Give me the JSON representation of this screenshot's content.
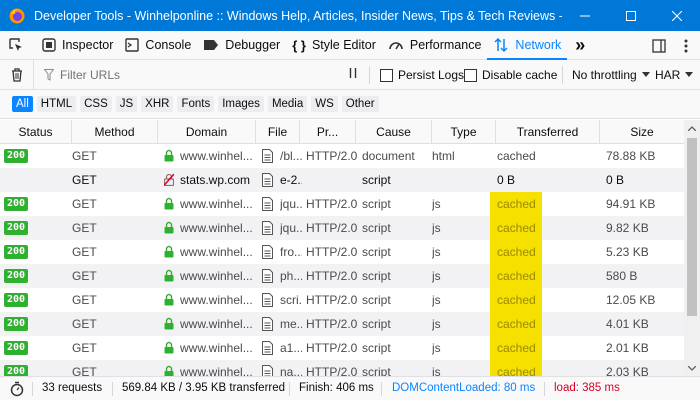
{
  "window": {
    "title": "Developer Tools - Winhelponline :: Windows Help, Articles, Insider News, Tips & Tech Reviews - htt..."
  },
  "toolbar": {
    "tools": [
      {
        "label": "Inspector",
        "icon": "inspector-icon"
      },
      {
        "label": "Console",
        "icon": "console-icon"
      },
      {
        "label": "Debugger",
        "icon": "debugger-icon"
      },
      {
        "label": "Style Editor",
        "icon": "style-editor-icon"
      },
      {
        "label": "Performance",
        "icon": "performance-icon"
      },
      {
        "label": "Network",
        "icon": "network-icon",
        "selected": true
      }
    ],
    "more": "»"
  },
  "filter": {
    "placeholder": "Filter URLs",
    "persist_logs": "Persist Logs",
    "disable_cache": "Disable cache",
    "throttling": "No throttling",
    "har": "HAR"
  },
  "types": [
    "All",
    "HTML",
    "CSS",
    "JS",
    "XHR",
    "Fonts",
    "Images",
    "Media",
    "WS",
    "Other"
  ],
  "columns": [
    "Status",
    "Method",
    "Domain",
    "File",
    "Pr...",
    "Cause",
    "Type",
    "Transferred",
    "Size"
  ],
  "rows": [
    {
      "status": "200",
      "method": "GET",
      "domain": "www.winhel...",
      "secure": true,
      "file": "/bl...",
      "protocol": "HTTP/2.0",
      "cause": "document",
      "type": "html",
      "transferred": "cached",
      "size": "78.88 KB",
      "highlight": false
    },
    {
      "status": "",
      "method": "GET",
      "domain": "stats.wp.com",
      "secure": false,
      "file": "e-2...",
      "protocol": "",
      "cause": "script",
      "type": "",
      "transferred": "0 B",
      "size": "0 B",
      "highlight": false
    },
    {
      "status": "200",
      "method": "GET",
      "domain": "www.winhel...",
      "secure": true,
      "file": "jqu...",
      "protocol": "HTTP/2.0",
      "cause": "script",
      "type": "js",
      "transferred": "cached",
      "size": "94.91 KB",
      "highlight": true
    },
    {
      "status": "200",
      "method": "GET",
      "domain": "www.winhel...",
      "secure": true,
      "file": "jqu...",
      "protocol": "HTTP/2.0",
      "cause": "script",
      "type": "js",
      "transferred": "cached",
      "size": "9.82 KB",
      "highlight": true
    },
    {
      "status": "200",
      "method": "GET",
      "domain": "www.winhel...",
      "secure": true,
      "file": "fro...",
      "protocol": "HTTP/2.0",
      "cause": "script",
      "type": "js",
      "transferred": "cached",
      "size": "5.23 KB",
      "highlight": true
    },
    {
      "status": "200",
      "method": "GET",
      "domain": "www.winhel...",
      "secure": true,
      "file": "ph...",
      "protocol": "HTTP/2.0",
      "cause": "script",
      "type": "js",
      "transferred": "cached",
      "size": "580 B",
      "highlight": true
    },
    {
      "status": "200",
      "method": "GET",
      "domain": "www.winhel...",
      "secure": true,
      "file": "scri...",
      "protocol": "HTTP/2.0",
      "cause": "script",
      "type": "js",
      "transferred": "cached",
      "size": "12.05 KB",
      "highlight": true
    },
    {
      "status": "200",
      "method": "GET",
      "domain": "www.winhel...",
      "secure": true,
      "file": "me...",
      "protocol": "HTTP/2.0",
      "cause": "script",
      "type": "js",
      "transferred": "cached",
      "size": "4.01 KB",
      "highlight": true
    },
    {
      "status": "200",
      "method": "GET",
      "domain": "www.winhel...",
      "secure": true,
      "file": "a1...",
      "protocol": "HTTP/2.0",
      "cause": "script",
      "type": "js",
      "transferred": "cached",
      "size": "2.01 KB",
      "highlight": true
    },
    {
      "status": "200",
      "method": "GET",
      "domain": "www.winhel...",
      "secure": true,
      "file": "na...",
      "protocol": "HTTP/2.0",
      "cause": "script",
      "type": "js",
      "transferred": "cached",
      "size": "2.03 KB",
      "highlight": true
    }
  ],
  "statusbar": {
    "requests": "33 requests",
    "size": "569.84 KB / 3.95 KB transferred",
    "finish": "Finish: 406 ms",
    "domcontentloaded": "DOMContentLoaded: 80 ms",
    "load": "load: 385 ms"
  },
  "colors": {
    "accent": "#0a84ff",
    "titlebar": "#0078d7",
    "status_ok": "#30b030",
    "highlight": "#f5e000",
    "dcl": "#0a84ff",
    "load": "#d70022"
  }
}
